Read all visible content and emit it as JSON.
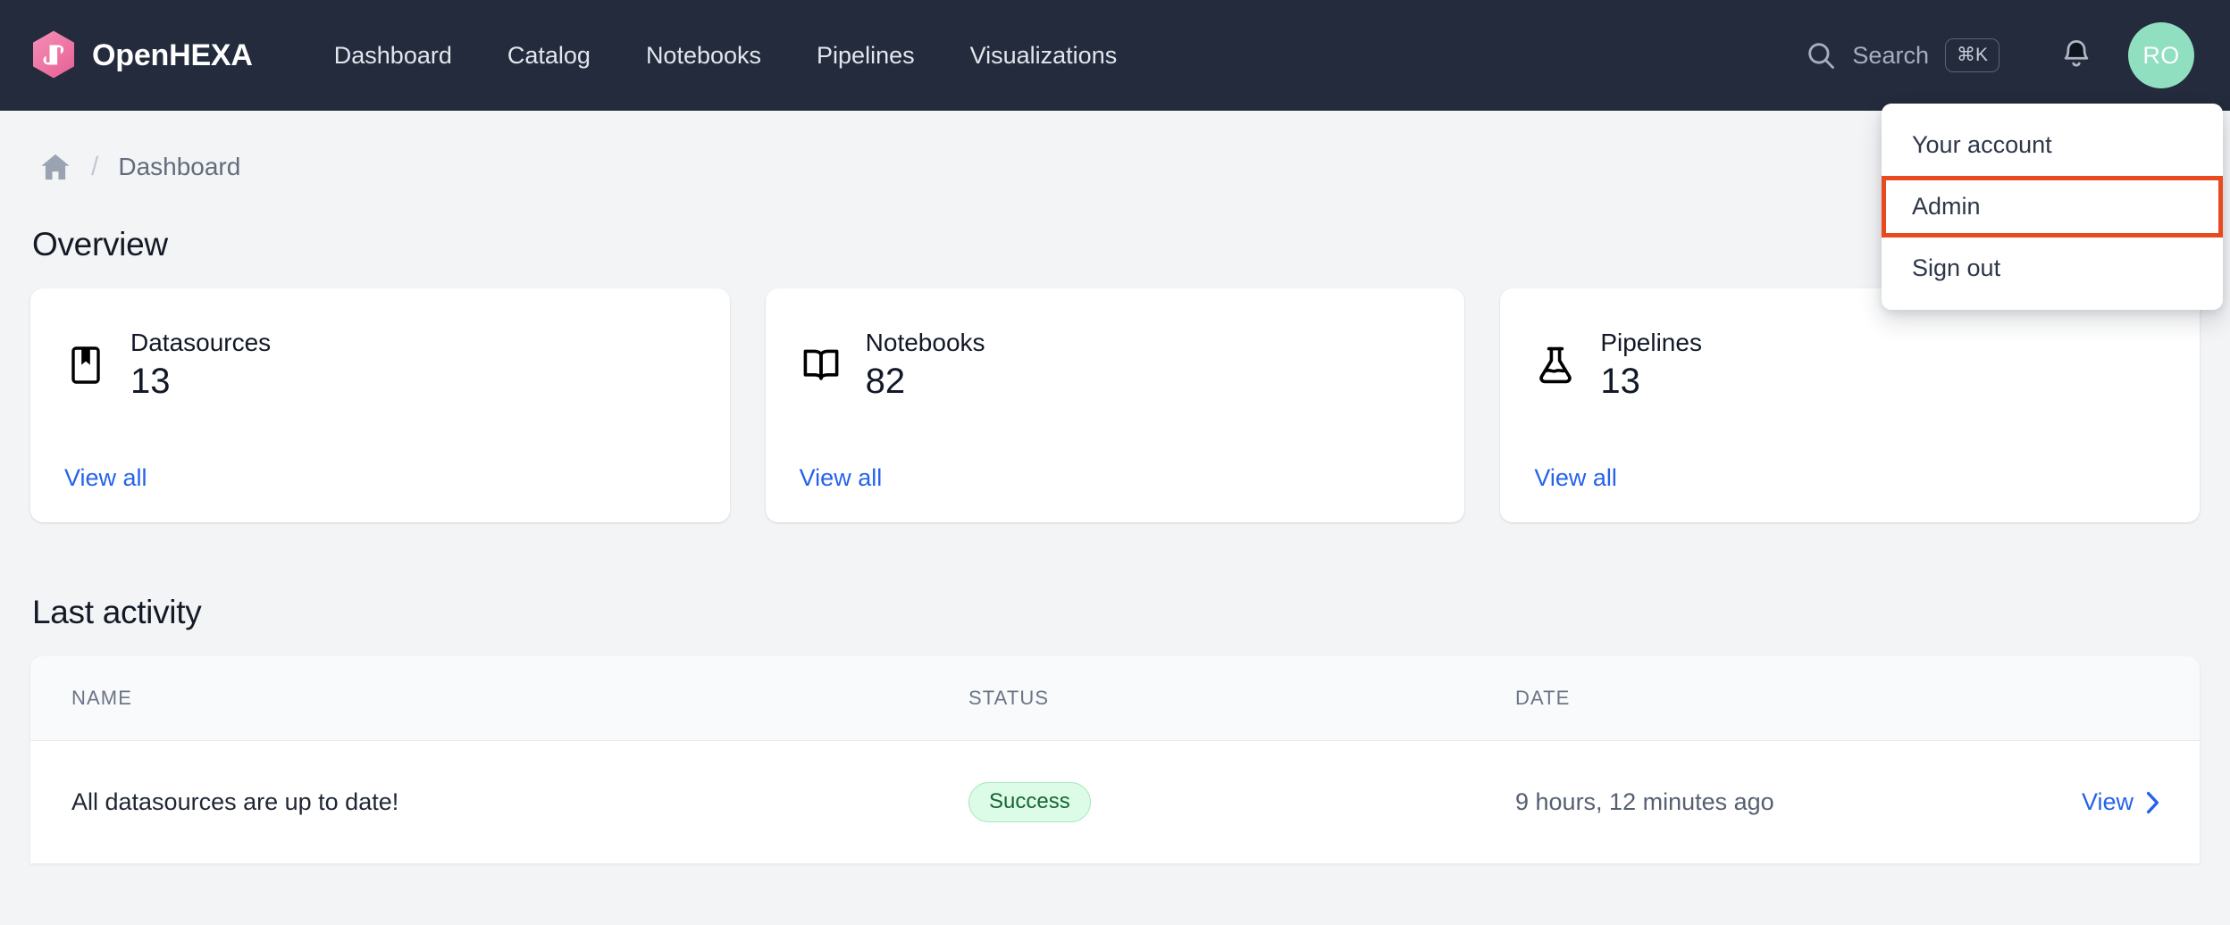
{
  "header": {
    "brand": {
      "name": "OpenHEXA",
      "logo_icon": "openhexa-hexagon-logo",
      "logo_color": "#ee7aa8"
    },
    "nav": [
      {
        "label": "Dashboard"
      },
      {
        "label": "Catalog"
      },
      {
        "label": "Notebooks"
      },
      {
        "label": "Pipelines"
      },
      {
        "label": "Visualizations"
      }
    ],
    "search": {
      "placeholder": "Search",
      "shortcut": "⌘K",
      "icon": "search-icon"
    },
    "notifications": {
      "icon": "bell-icon"
    },
    "avatar": {
      "initials": "RO",
      "color": "#8fdfc0"
    }
  },
  "user_menu": {
    "items": [
      {
        "label": "Your account",
        "highlighted": false
      },
      {
        "label": "Admin",
        "highlighted": true
      },
      {
        "label": "Sign out",
        "highlighted": false
      }
    ],
    "highlight_color": "#e8491e"
  },
  "breadcrumb": {
    "home_icon": "home-icon",
    "separator": "/",
    "current": "Dashboard"
  },
  "overview": {
    "title": "Overview",
    "cards": [
      {
        "icon": "bookmark-icon",
        "label": "Datasources",
        "value": "13",
        "link": "View all"
      },
      {
        "icon": "open-book-icon",
        "label": "Notebooks",
        "value": "82",
        "link": "View all"
      },
      {
        "icon": "beaker-icon",
        "label": "Pipelines",
        "value": "13",
        "link": "View all"
      }
    ]
  },
  "activity": {
    "title": "Last activity",
    "columns": [
      "NAME",
      "STATUS",
      "DATE",
      ""
    ],
    "rows": [
      {
        "name": "All datasources are up to date!",
        "status": "Success",
        "status_color": "#166534",
        "date": "9 hours, 12 minutes ago",
        "action": "View"
      }
    ]
  }
}
